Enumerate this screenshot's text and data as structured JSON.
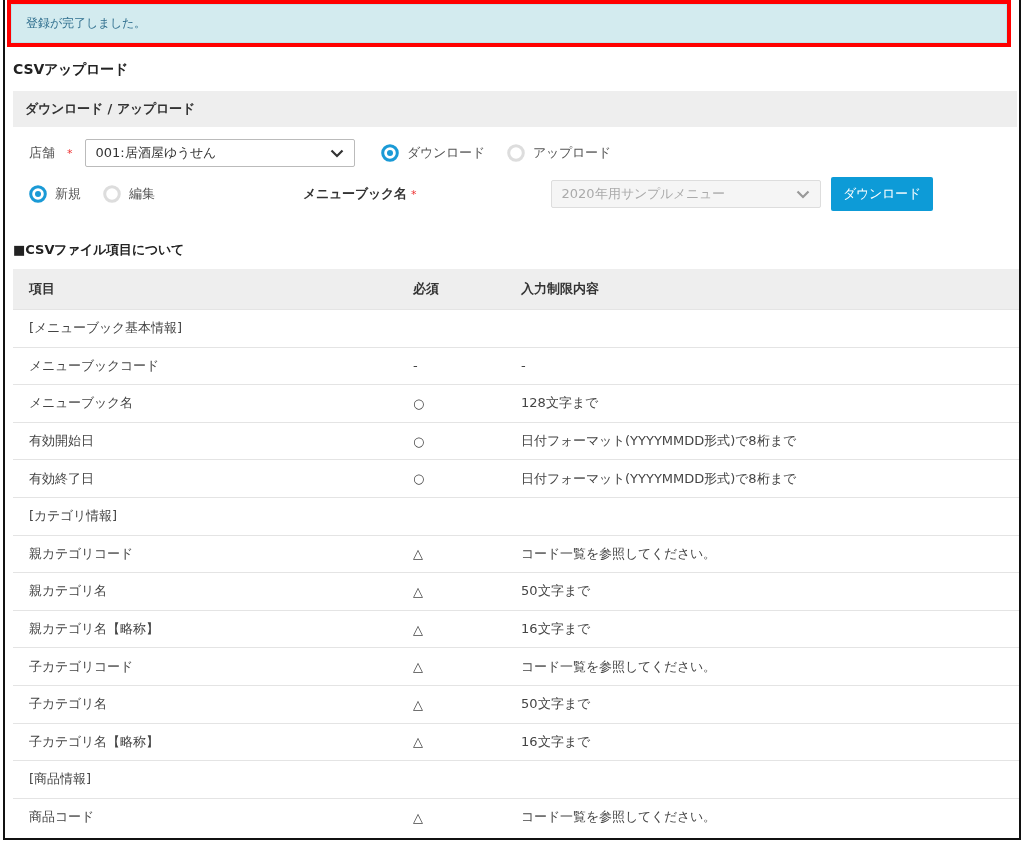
{
  "alert": {
    "message": "登録が完了しました。",
    "highlighted": true
  },
  "page_title": "CSVアップロード",
  "panel": {
    "title": "ダウンロード / アップロード",
    "store": {
      "label": "店舗",
      "required_mark": "*",
      "value": "001:居酒屋ゆうせん"
    },
    "direction_options": [
      {
        "label": "ダウンロード",
        "selected": true
      },
      {
        "label": "アップロード",
        "selected": false
      }
    ],
    "mode_options": [
      {
        "label": "新規",
        "selected": true
      },
      {
        "label": "編集",
        "selected": false
      }
    ],
    "menu_book": {
      "label": "メニューブック名",
      "required_mark": "*",
      "value": "2020年用サンプルメニュー",
      "disabled": true
    },
    "button": "ダウンロード"
  },
  "section_title": "■CSVファイル項目について",
  "table": {
    "columns": [
      "項目",
      "必須",
      "入力制限内容"
    ],
    "rows": [
      {
        "kind": "group",
        "item": "[メニューブック基本情報]"
      },
      {
        "kind": "field",
        "item": "メニューブックコード",
        "required": "-",
        "restriction": "-"
      },
      {
        "kind": "field",
        "item": "メニューブック名",
        "required": "○",
        "restriction": "128文字まで"
      },
      {
        "kind": "field",
        "item": "有効開始日",
        "required": "○",
        "restriction": "日付フォーマット(YYYYMMDD形式)で8桁まで"
      },
      {
        "kind": "field",
        "item": "有効終了日",
        "required": "○",
        "restriction": "日付フォーマット(YYYYMMDD形式)で8桁まで"
      },
      {
        "kind": "group",
        "item": "[カテゴリ情報]"
      },
      {
        "kind": "field",
        "item": "親カテゴリコード",
        "required": "△",
        "restriction": "コード一覧を参照してください。"
      },
      {
        "kind": "field",
        "item": "親カテゴリ名",
        "required": "△",
        "restriction": "50文字まで"
      },
      {
        "kind": "field",
        "item": "親カテゴリ名【略称】",
        "required": "△",
        "restriction": "16文字まで"
      },
      {
        "kind": "field",
        "item": "子カテゴリコード",
        "required": "△",
        "restriction": "コード一覧を参照してください。"
      },
      {
        "kind": "field",
        "item": "子カテゴリ名",
        "required": "△",
        "restriction": "50文字まで"
      },
      {
        "kind": "field",
        "item": "子カテゴリ名【略称】",
        "required": "△",
        "restriction": "16文字まで"
      },
      {
        "kind": "group",
        "item": "[商品情報]"
      },
      {
        "kind": "field",
        "item": "商品コード",
        "required": "△",
        "restriction": "コード一覧を参照してください。"
      }
    ]
  }
}
